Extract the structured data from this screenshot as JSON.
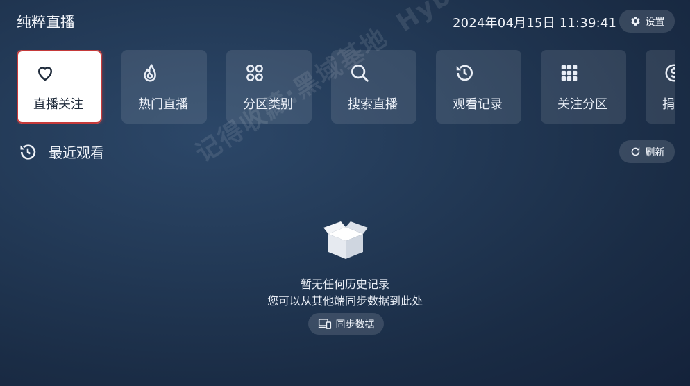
{
  "header": {
    "title": "纯粹直播",
    "datetime": "2024年04月15日 11:39:41",
    "settings_label": "设置"
  },
  "tiles": [
    {
      "label": "直播关注",
      "icon": "heart-icon",
      "active": true
    },
    {
      "label": "热门直播",
      "icon": "flame-icon",
      "active": false
    },
    {
      "label": "分区类别",
      "icon": "command-icon",
      "active": false
    },
    {
      "label": "搜索直播",
      "icon": "search-icon",
      "active": false
    },
    {
      "label": "观看记录",
      "icon": "history-icon",
      "active": false
    },
    {
      "label": "关注分区",
      "icon": "grid-icon",
      "active": false
    },
    {
      "label": "捐",
      "icon": "dollar-icon",
      "active": false
    }
  ],
  "recent": {
    "title": "最近观看",
    "refresh_label": "刷新"
  },
  "empty": {
    "line1": "暂无任何历史记录",
    "line2": "您可以从其他端同步数据到此处",
    "sync_label": "同步数据"
  },
  "watermark": {
    "text": "记得收藏:黑域基地",
    "sub": "Hybase.com"
  },
  "colors": {
    "active_tile_border": "#c63a3a",
    "background": "#1f3350"
  }
}
